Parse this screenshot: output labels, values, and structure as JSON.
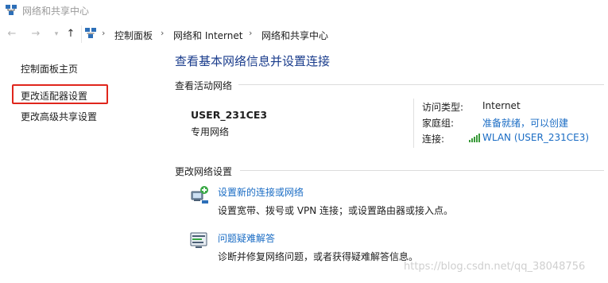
{
  "window": {
    "title": "网络和共享中心",
    "icon": "network-center-icon"
  },
  "address": {
    "nav": {
      "back_icon": "back-arrow-icon",
      "forward_icon": "forward-arrow-icon",
      "recent_icon": "chevron-down-icon",
      "up_icon": "up-arrow-icon"
    },
    "breadcrumbs": [
      "控制面板",
      "网络和 Internet",
      "网络和共享中心"
    ],
    "separator": "›"
  },
  "sidebar": {
    "items": [
      {
        "label": "控制面板主页"
      },
      {
        "label": "更改适配器设置",
        "highlighted": true
      },
      {
        "label": "更改高级共享设置"
      }
    ],
    "highlight_color": "#e0261c"
  },
  "main": {
    "title": "查看基本网络信息并设置连接",
    "active_section": {
      "label": "查看活动网络",
      "network_name": "USER_231CE3",
      "network_type": "专用网络",
      "access_type_label": "访问类型:",
      "access_type_value": "Internet",
      "homegroup_label": "家庭组:",
      "homegroup_value": "准备就绪，可以创建",
      "connection_label": "连接:",
      "connection_value": "WLAN (USER_231CE3)",
      "connection_icon": "wifi-signal-icon"
    },
    "settings_section": {
      "label": "更改网络设置",
      "tasks": [
        {
          "icon": "new-connection-icon",
          "title": "设置新的连接或网络",
          "description": "设置宽带、拨号或 VPN 连接；或设置路由器或接入点。"
        },
        {
          "icon": "troubleshoot-icon",
          "title": "问题疑难解答",
          "description": "诊断并修复网络问题，或者获得疑难解答信息。"
        }
      ]
    }
  },
  "watermark": "https://blog.csdn.net/qq_38048756",
  "colors": {
    "title_blue": "#1a3c8c",
    "link_blue": "#1a6cc4",
    "wifi_green": "#3a9a3a"
  }
}
